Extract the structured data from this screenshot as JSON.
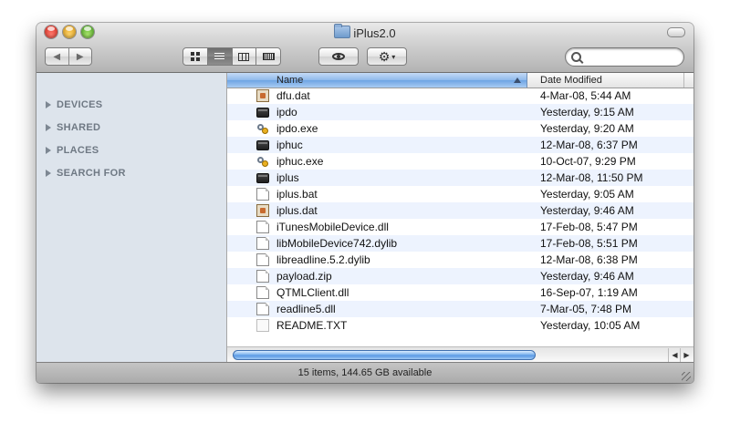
{
  "window": {
    "title": "iPlus2.0"
  },
  "toolbar": {
    "back_icon": "◀",
    "forward_icon": "▶",
    "action_icon": "⚙",
    "action_caret": "▾",
    "search": {
      "value": "",
      "placeholder": ""
    }
  },
  "sidebar": {
    "sections": [
      "DEVICES",
      "SHARED",
      "PLACES",
      "SEARCH FOR"
    ]
  },
  "columns": {
    "name": "Name",
    "date": "Date Modified"
  },
  "files": [
    {
      "name": "dfu.dat",
      "date": "4-Mar-08, 5:44 AM",
      "icon": "dat-file-icon"
    },
    {
      "name": "ipdo",
      "date": "Yesterday, 9:15 AM",
      "icon": "unix-executable-icon"
    },
    {
      "name": "ipdo.exe",
      "date": "Yesterday, 9:20 AM",
      "icon": "windows-exe-icon"
    },
    {
      "name": "iphuc",
      "date": "12-Mar-08, 6:37 PM",
      "icon": "unix-executable-icon"
    },
    {
      "name": "iphuc.exe",
      "date": "10-Oct-07, 9:29 PM",
      "icon": "windows-exe-icon"
    },
    {
      "name": "iplus",
      "date": "12-Mar-08, 11:50 PM",
      "icon": "unix-executable-icon"
    },
    {
      "name": "iplus.bat",
      "date": "Yesterday, 9:05 AM",
      "icon": "document-icon"
    },
    {
      "name": "iplus.dat",
      "date": "Yesterday, 9:46 AM",
      "icon": "dat-file-icon"
    },
    {
      "name": "iTunesMobileDevice.dll",
      "date": "17-Feb-08, 5:47 PM",
      "icon": "document-icon"
    },
    {
      "name": "libMobileDevice742.dylib",
      "date": "17-Feb-08, 5:51 PM",
      "icon": "document-icon"
    },
    {
      "name": "libreadline.5.2.dylib",
      "date": "12-Mar-08, 6:38 PM",
      "icon": "document-icon"
    },
    {
      "name": "payload.zip",
      "date": "Yesterday, 9:46 AM",
      "icon": "document-icon"
    },
    {
      "name": "QTMLClient.dll",
      "date": "16-Sep-07, 1:19 AM",
      "icon": "document-icon"
    },
    {
      "name": "readline5.dll",
      "date": "7-Mar-05, 7:48 PM",
      "icon": "document-icon"
    },
    {
      "name": "README.TXT",
      "date": "Yesterday, 10:05 AM",
      "icon": "text-file-icon"
    }
  ],
  "scroll": {
    "left_icon": "◀",
    "right_icon": "▶"
  },
  "status": {
    "text": "15 items, 144.65 GB available"
  }
}
